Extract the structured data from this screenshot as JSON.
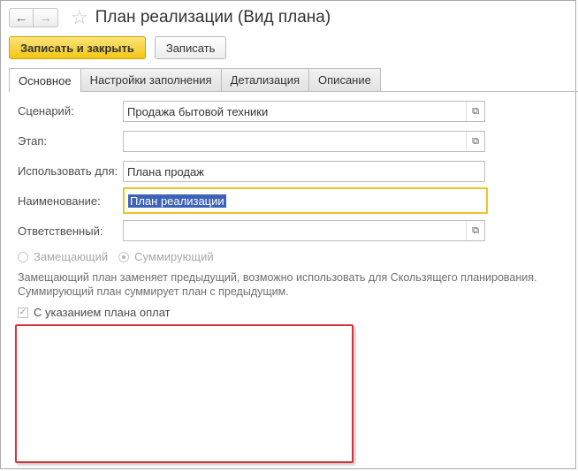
{
  "window": {
    "title": "План реализации (Вид плана)"
  },
  "nav": {
    "back_icon": "arrow-left-icon",
    "forward_icon": "arrow-right-icon",
    "favorite_icon": "star-icon"
  },
  "toolbar": {
    "save_close_label": "Записать и закрыть",
    "save_label": "Записать"
  },
  "tabs": [
    {
      "label": "Основное",
      "active": true
    },
    {
      "label": "Настройки заполнения",
      "active": false
    },
    {
      "label": "Детализация",
      "active": false
    },
    {
      "label": "Описание",
      "active": false
    }
  ],
  "form": {
    "scenario": {
      "label": "Сценарий:",
      "value": "Продажа бытовой техники"
    },
    "stage": {
      "label": "Этап:",
      "value": ""
    },
    "use_for": {
      "label": "Использовать для:",
      "value": "Плана продаж"
    },
    "name": {
      "label": "Наименование:",
      "value": "План реализации"
    },
    "responsible": {
      "label": "Ответственный:",
      "value": ""
    }
  },
  "plan_mode": {
    "options": [
      "Замещающий",
      "Суммирующий"
    ],
    "selected": "Суммирующий",
    "hint_line1": "Замещающий план заменяет предыдущий, возможно использовать для Скользящего планирования.",
    "hint_line2": "Суммирующий план суммирует план с предыдущим."
  },
  "payment_plan": {
    "label": "С указанием плана оплат",
    "checked": true
  },
  "colors": {
    "primary_button": "#f3c614",
    "focus_border": "#f0c22a",
    "selection": "#3d63b8",
    "highlight_box": "#d6343a"
  }
}
